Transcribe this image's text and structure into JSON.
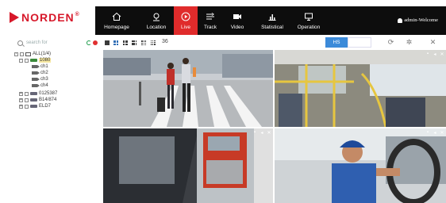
{
  "brand": {
    "name": "NORDEN",
    "reg": "®"
  },
  "nav": {
    "items": [
      {
        "label": "Homepage",
        "icon": "home-icon"
      },
      {
        "label": "Location",
        "icon": "location-icon"
      },
      {
        "label": "Live",
        "icon": "play-icon",
        "active": true
      },
      {
        "label": "Track",
        "icon": "track-icon"
      },
      {
        "label": "Video",
        "icon": "video-icon"
      },
      {
        "label": "Statistical",
        "icon": "chart-icon"
      },
      {
        "label": "Operation",
        "icon": "monitor-icon"
      }
    ],
    "user": "admin-Welcome"
  },
  "toolbar": {
    "search_placeholder": "search for",
    "layout_count": "36",
    "stream_button": "HS"
  },
  "tree": {
    "root": "ALL(1/4)",
    "vehicle": "1080",
    "channels": [
      "ch1",
      "ch2",
      "ch3",
      "ch4"
    ],
    "others": [
      "0125387",
      "B14/874",
      "ELD7"
    ]
  },
  "colors": {
    "accent": "#e02b2b",
    "brand": "#d7182a",
    "navbar": "#0d0d0d",
    "button_blue": "#3b8ad9"
  },
  "tiles": [
    {
      "name": "street-camera-view"
    },
    {
      "name": "bus-interior-view"
    },
    {
      "name": "side-mirror-truck-view"
    },
    {
      "name": "driver-cabin-view"
    }
  ]
}
